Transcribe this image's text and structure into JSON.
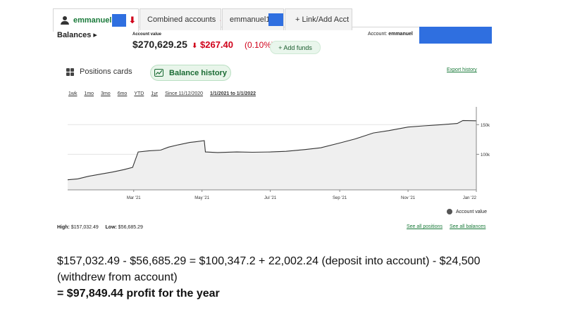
{
  "tabs": [
    {
      "label": "emmanuel",
      "active": true
    },
    {
      "label": "Combined accounts",
      "active": false
    },
    {
      "label": "emmanuel1",
      "active": false
    },
    {
      "label": "+ Link/Add Acct",
      "active": false
    }
  ],
  "header": {
    "balances_label": "Balances ▸",
    "account_value_label": "Account value",
    "account_value": "$270,629.25",
    "change_arrow": "⬇",
    "change_amount": "$267.40",
    "change_pct": "(0.10%)",
    "add_funds": "+ Add funds",
    "account_label": "Account:",
    "account_name": "emmanuel"
  },
  "view": {
    "positions_cards": "Positions cards",
    "balance_history": "Balance history",
    "export_history": "Export history"
  },
  "ranges": [
    "1wk",
    "1mo",
    "3mo",
    "6mo",
    "YTD",
    "1yr",
    "Since 11/12/2020",
    "1/1/2021 to 1/1/2022"
  ],
  "selected_range": "1/1/2021 to 1/1/2022",
  "chart_data": {
    "type": "area",
    "x": [
      "2021-01-01",
      "2021-01-10",
      "2021-01-20",
      "2021-02-01",
      "2021-02-10",
      "2021-02-20",
      "2021-02-28",
      "2021-03-05",
      "2021-03-15",
      "2021-03-25",
      "2021-04-01",
      "2021-04-10",
      "2021-04-20",
      "2021-04-25",
      "2021-05-03",
      "2021-05-04",
      "2021-05-15",
      "2021-06-01",
      "2021-06-15",
      "2021-07-01",
      "2021-07-15",
      "2021-08-01",
      "2021-08-15",
      "2021-09-01",
      "2021-09-15",
      "2021-10-01",
      "2021-10-15",
      "2021-11-01",
      "2021-11-15",
      "2021-12-01",
      "2021-12-15",
      "2021-12-20",
      "2022-01-01"
    ],
    "values": [
      57000,
      58500,
      63000,
      67000,
      70000,
      74000,
      78000,
      104000,
      106000,
      107000,
      112000,
      116000,
      120000,
      121000,
      123000,
      104000,
      103000,
      104000,
      103500,
      104000,
      105000,
      108000,
      111000,
      119000,
      126000,
      136000,
      140000,
      146000,
      148000,
      150000,
      152000,
      157000,
      156500
    ],
    "ylim": [
      40000,
      180000
    ],
    "y_ticks": [
      "100k",
      "150k"
    ],
    "y_tick_values": [
      100000,
      150000
    ],
    "x_tick_labels": [
      "Mar '21",
      "May '21",
      "Jul '21",
      "Sep '21",
      "Nov '21",
      "Jan '22"
    ],
    "x_tick_values": [
      "2021-03-01",
      "2021-05-01",
      "2021-07-01",
      "2021-09-01",
      "2021-11-01",
      "2022-01-01"
    ],
    "legend": "Account value",
    "grid": true,
    "fill_color": "#efefef",
    "line_color": "#333333"
  },
  "stats": {
    "high_label": "High:",
    "high_value": "$157,032.49",
    "low_label": "Low:",
    "low_value": "$56,685.29",
    "see_positions": "See all positions",
    "see_balances": "See all balances"
  },
  "notes": {
    "line1": "$157,032.49 - $56,685.29 = $100,347.2 + 22,002.24 (deposit into account) - $24,500",
    "line2": "(withdrew from account)",
    "line3": "= $97,849.44 profit for the year"
  },
  "colors": {
    "accent_green": "#1a7a3a",
    "loss_red": "#d0021b",
    "redaction_blue": "#2f6fe0"
  }
}
